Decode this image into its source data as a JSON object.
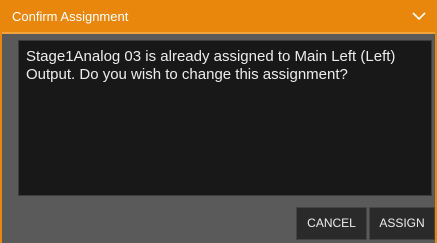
{
  "dialog": {
    "title": "Confirm Assignment",
    "collapse_icon": "chevron-down-icon",
    "message": "Stage1Analog 03 is already assigned to Main Left (Left) Output. Do you wish to change this assignment?",
    "buttons": {
      "cancel": "CANCEL",
      "assign": "ASSIGN"
    }
  },
  "colors": {
    "accent": "#e8870c",
    "dialog_body": "#5a5a5a",
    "message_background": "#181818",
    "button_background": "#2a2a2a",
    "text": "#ececec"
  }
}
